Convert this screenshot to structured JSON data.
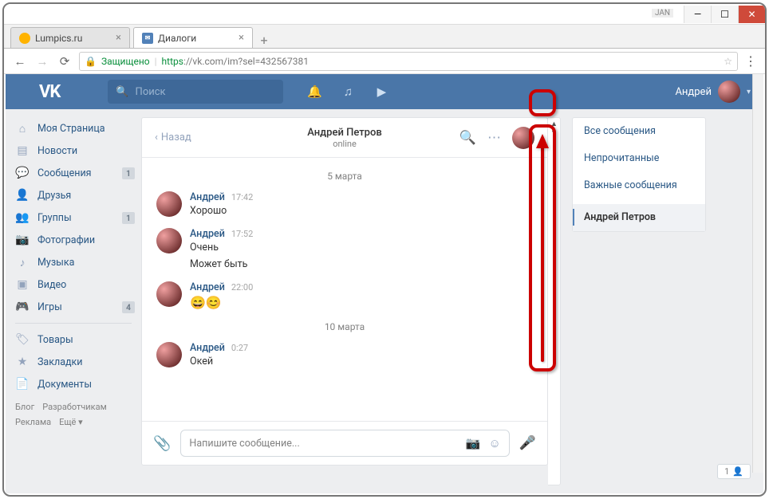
{
  "window": {
    "jan": "JAN"
  },
  "tabs": {
    "lumpics": "Lumpics.ru",
    "dialogs": "Диалоги"
  },
  "omnibox": {
    "secure": "Защищено",
    "proto": "https",
    "rest": "://vk.com/im?sel=432567381"
  },
  "header": {
    "logo": "VK",
    "search_placeholder": "Поиск",
    "username": "Андрей"
  },
  "sidebar": {
    "items": [
      {
        "label": "Моя Страница"
      },
      {
        "label": "Новости"
      },
      {
        "label": "Сообщения",
        "badge": "1"
      },
      {
        "label": "Друзья"
      },
      {
        "label": "Группы",
        "badge": "1"
      },
      {
        "label": "Фотографии"
      },
      {
        "label": "Музыка"
      },
      {
        "label": "Видео"
      },
      {
        "label": "Игры",
        "badge": "4"
      }
    ],
    "more": [
      {
        "label": "Товары"
      },
      {
        "label": "Закладки"
      },
      {
        "label": "Документы"
      }
    ],
    "footer": {
      "blog": "Блог",
      "dev": "Разработчикам",
      "ads": "Реклама",
      "more": "Ещё ▾"
    }
  },
  "chat": {
    "back": "Назад",
    "title": "Андрей Петров",
    "status": "online",
    "date1": "5 марта",
    "date2": "10 марта",
    "m1": {
      "author": "Андрей",
      "time": "17:42",
      "text": "Хорошо"
    },
    "m2": {
      "author": "Андрей",
      "time": "17:52",
      "text": "Очень",
      "extra": "Может быть"
    },
    "m3": {
      "author": "Андрей",
      "time": "22:00",
      "emoji": "😄😊"
    },
    "m4": {
      "author": "Андрей",
      "time": "0:27",
      "text": "Окей"
    },
    "input_placeholder": "Напишите сообщение..."
  },
  "filters": {
    "all": "Все сообщения",
    "unread": "Непрочитанные",
    "important": "Важные сообщения",
    "pinned": "Андрей Петров"
  },
  "count_widget": "1"
}
